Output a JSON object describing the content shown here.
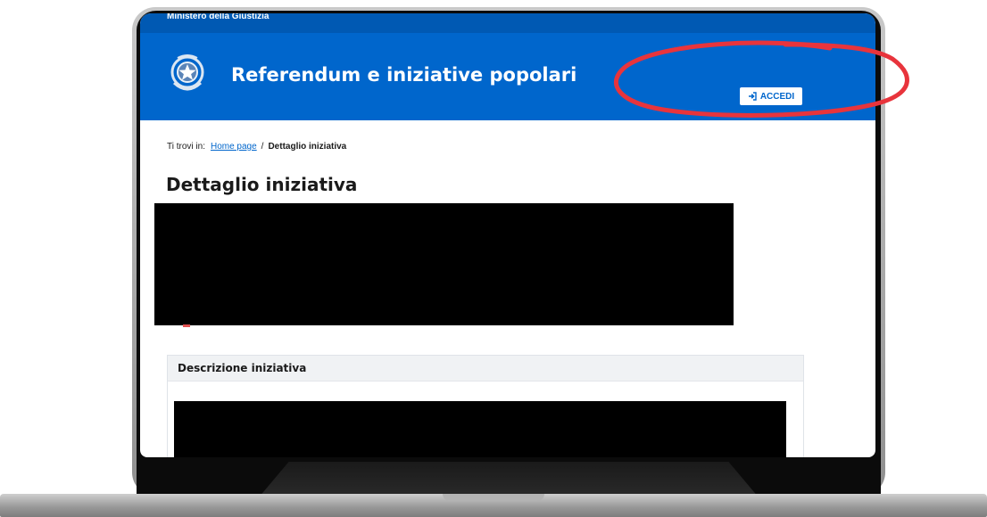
{
  "header": {
    "ministry": "Ministero della Giustizia",
    "site_title": "Referendum e iniziative popolari",
    "login_label": "ACCEDI",
    "login_icon": "sign-in-icon",
    "emblem_icon": "italian-republic-emblem"
  },
  "breadcrumb": {
    "prefix": "Ti trovi in:",
    "home": "Home page",
    "separator": "/",
    "current": "Dettaglio iniziativa"
  },
  "main": {
    "title": "Dettaglio iniziativa",
    "panel_title": "Descrizione iniziativa"
  },
  "annotation": {
    "color": "#e8343c",
    "shape": "hand-drawn ellipse around login button"
  },
  "colors": {
    "header_blue": "#0066cc",
    "topbar_blue": "#0059b3",
    "link_blue": "#0066cc",
    "redaction": "#000000"
  }
}
